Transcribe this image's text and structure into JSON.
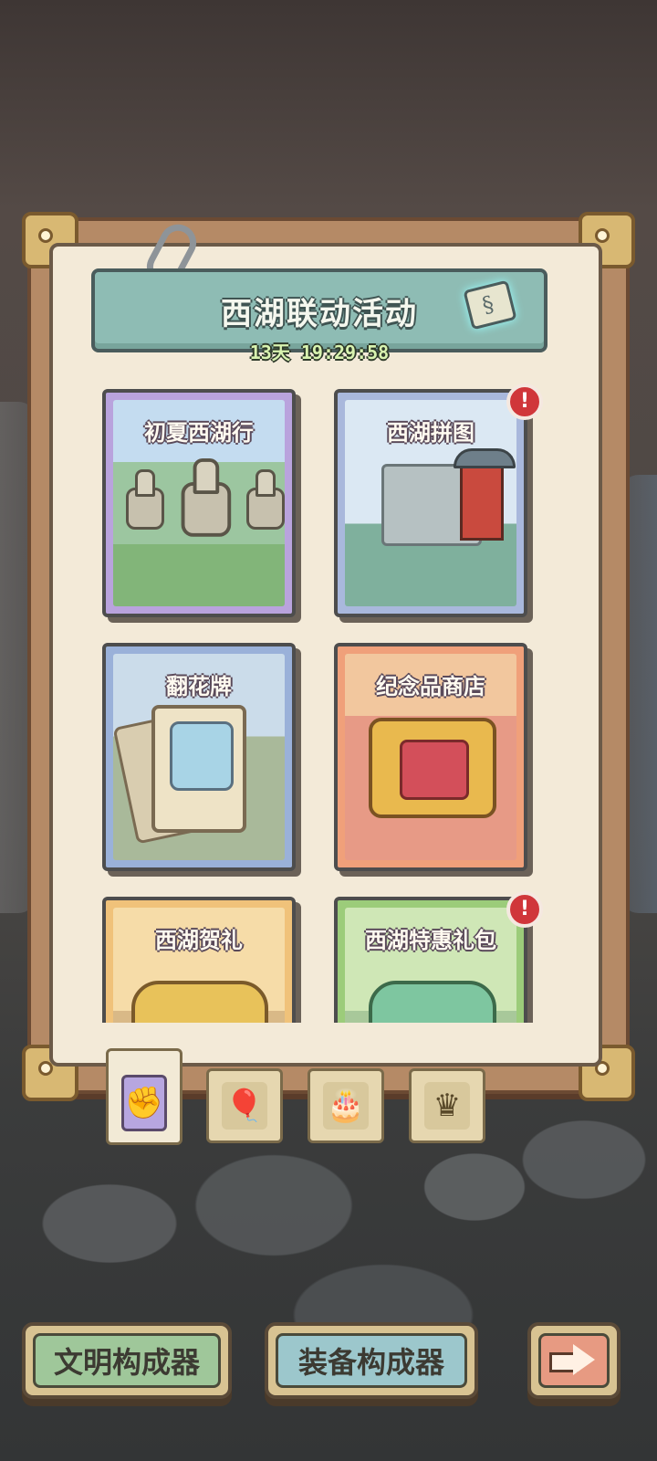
{
  "event": {
    "title": "西湖联动活动",
    "timer": "13天 19:29:58"
  },
  "cards": [
    {
      "label": "初夏西湖行",
      "alert": false
    },
    {
      "label": "西湖拼图",
      "alert": true
    },
    {
      "label": "翻花牌",
      "alert": false
    },
    {
      "label": "纪念品商店",
      "alert": false
    },
    {
      "label": "西湖贺礼",
      "alert": false
    },
    {
      "label": "西湖特惠礼包",
      "alert": true
    }
  ],
  "alert_symbol": "!",
  "tabs": [
    {
      "icon": "fist-hammer-icon",
      "glyph": "✊",
      "active": true
    },
    {
      "icon": "hot-air-balloon-icon",
      "glyph": "🎈",
      "active": false
    },
    {
      "icon": "cake-icon",
      "glyph": "🎂",
      "active": false
    },
    {
      "icon": "crown-icon",
      "glyph": "♛",
      "active": false
    }
  ],
  "bottom_buttons": {
    "civilization": "文明构成器",
    "equipment": "装备构成器",
    "next_icon": "arrow-right-icon"
  },
  "colors": {
    "banner": "#8ebcb4",
    "alert": "#d0363a",
    "civ_button": "#9fc79a",
    "equip_button": "#9cc7cc",
    "next_button": "#e79a82"
  }
}
